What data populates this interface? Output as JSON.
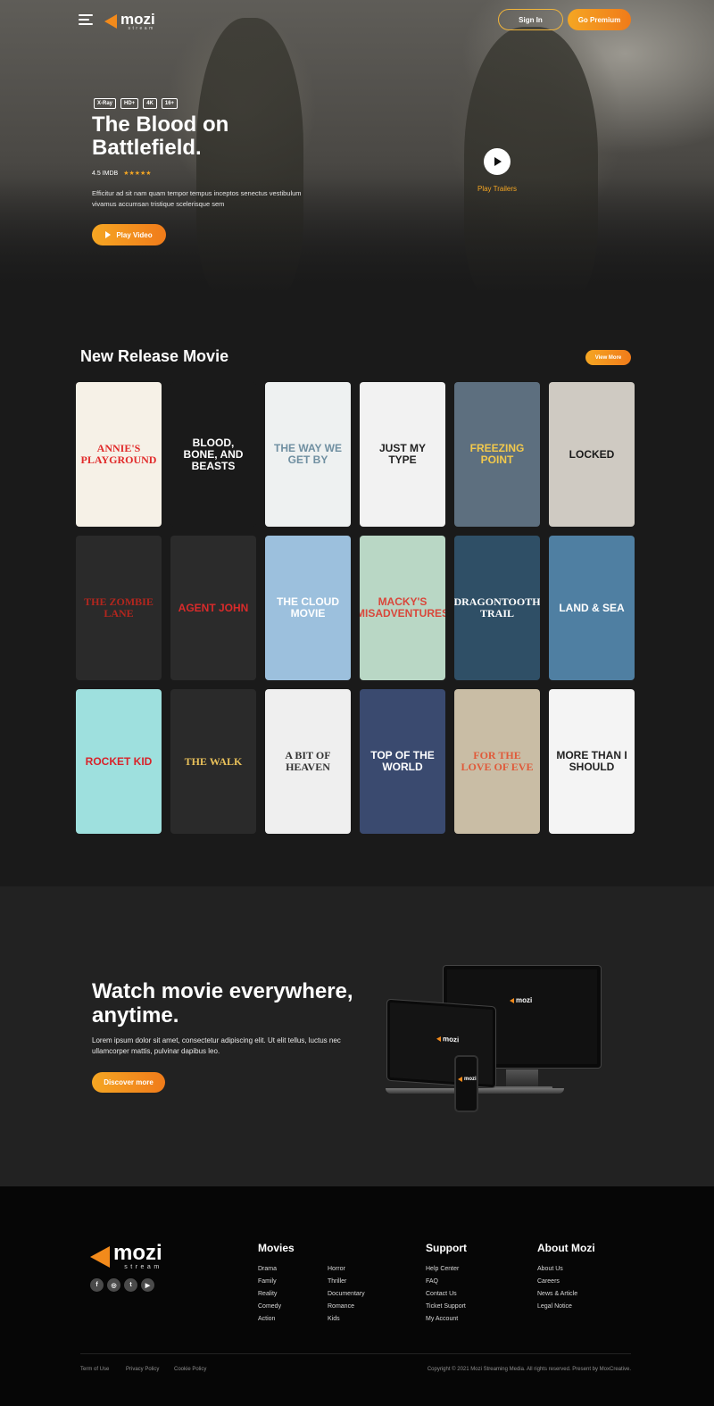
{
  "colors": {
    "accent": "#f5a623",
    "accent_dark": "#f07b1a",
    "background": "#1a1a1a",
    "footer_bg": "#060606"
  },
  "header": {
    "logo_word": "mozi",
    "logo_sub": "stream",
    "signin_label": "Sign In",
    "premium_label": "Go Premium"
  },
  "hero": {
    "badges": [
      "X-Ray",
      "HD+",
      "4K",
      "16+"
    ],
    "title": "The Blood on Battlefield.",
    "imdb": "4.5 IMDB",
    "stars": "★★★★★",
    "star_rating": 4.5,
    "description": "Efficitur ad sit nam quam tempor tempus inceptos senectus vestibulum vivamus accumsan tristique scelerisque sem",
    "play_label": "Play Video",
    "trailer_label": "Play Trailers"
  },
  "releases": {
    "title": "New Release Movie",
    "view_more": "View More",
    "posters": [
      {
        "title": "Annie's Playground",
        "bg": "#f6f1e7",
        "fg": "#e12a2a",
        "font": "serif"
      },
      {
        "title": "Blood, Bone, and Beasts",
        "bg": "#1a1a1a",
        "fg": "#ffffff",
        "font": "sans"
      },
      {
        "title": "The Way We Get By",
        "bg": "#eef1f1",
        "fg": "#6f8fa1",
        "font": "sans"
      },
      {
        "title": "Just My Type",
        "bg": "#f2f2f2",
        "fg": "#222222",
        "font": "sans"
      },
      {
        "title": "Freezing Point",
        "bg": "#5d6f7f",
        "fg": "#f2c94c",
        "font": "sans"
      },
      {
        "title": "Locked",
        "bg": "#cfcac2",
        "fg": "#1a1a1a",
        "font": "sans"
      },
      {
        "title": "The Zombie Lane",
        "bg": "#2a2a2a",
        "fg": "#b3261e",
        "font": "serif"
      },
      {
        "title": "Agent John",
        "bg": "#2b2b2b",
        "fg": "#d92b2b",
        "font": "sans"
      },
      {
        "title": "The Cloud Movie",
        "bg": "#9cc0dd",
        "fg": "#ffffff",
        "font": "sans"
      },
      {
        "title": "Macky's Misadventures",
        "bg": "#b9d7c5",
        "fg": "#d9473b",
        "font": "sans"
      },
      {
        "title": "Dragontooth Trail",
        "bg": "#2f4f66",
        "fg": "#ffffff",
        "font": "serif"
      },
      {
        "title": "Land & Sea",
        "bg": "#4f7fa2",
        "fg": "#ffffff",
        "font": "sans"
      },
      {
        "title": "Rocket Kid",
        "bg": "#9ee0de",
        "fg": "#d8232a",
        "font": "sans"
      },
      {
        "title": "The Walk",
        "bg": "#2a2a2a",
        "fg": "#e8c05a",
        "font": "serif"
      },
      {
        "title": "A Bit of Heaven",
        "bg": "#efefef",
        "fg": "#333333",
        "font": "serif"
      },
      {
        "title": "Top of the World",
        "bg": "#3a4a6f",
        "fg": "#ffffff",
        "font": "sans"
      },
      {
        "title": "For the Love of Eve",
        "bg": "#c9bda5",
        "fg": "#e05a3a",
        "font": "serif"
      },
      {
        "title": "More Than I Should",
        "bg": "#f4f4f4",
        "fg": "#222222",
        "font": "sans"
      }
    ]
  },
  "watch": {
    "title": "Watch movie everywhere, anytime.",
    "description": "Lorem ipsum dolor sit amet, consectetur adipiscing elit. Ut elit tellus, luctus nec ullamcorper mattis, pulvinar dapibus leo.",
    "button": "Discover more",
    "device_logo": "mozi"
  },
  "footer": {
    "logo_word": "mozi",
    "logo_sub": "stream",
    "social_icons": [
      "facebook-icon",
      "instagram-icon",
      "twitter-icon",
      "youtube-icon"
    ],
    "movies_title": "Movies",
    "movies_col1": [
      "Drama",
      "Family",
      "Reality",
      "Comedy",
      "Action"
    ],
    "movies_col2": [
      "Horror",
      "Thriller",
      "Documentary",
      "Romance",
      "Kids"
    ],
    "support_title": "Support",
    "support": [
      "Help Center",
      "FAQ",
      "Contact Us",
      "Ticket Support",
      "My Account"
    ],
    "about_title": "About Mozi",
    "about": [
      "About Us",
      "Careers",
      "News & Article",
      "Legal Notice"
    ],
    "legal_links": [
      "Term of Use",
      "Privacy Policy",
      "Cookie Policy"
    ],
    "copyright": "Copyright © 2021 Mozi Streaming Media. All rights reserved. Present by MoxCreative."
  }
}
